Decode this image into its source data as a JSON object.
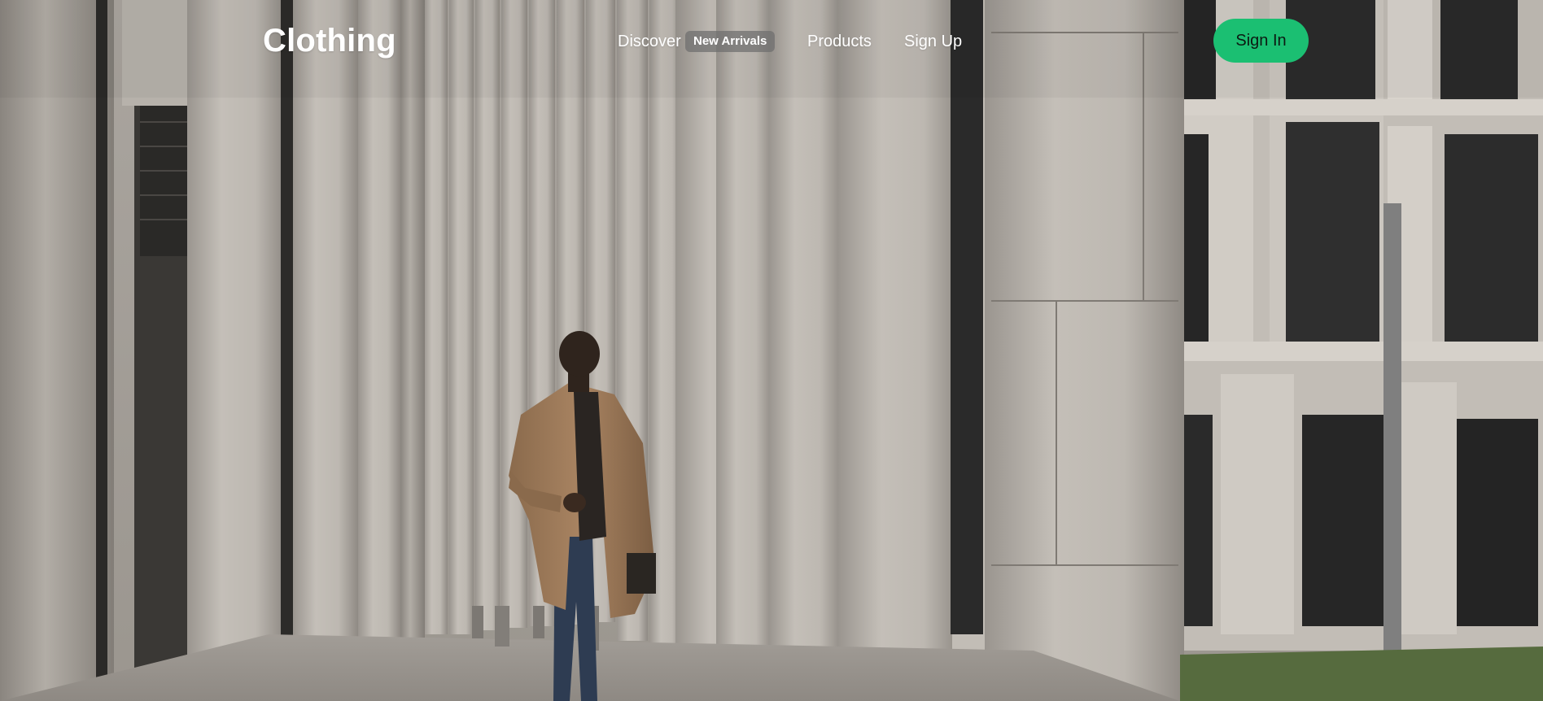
{
  "brand": {
    "logo_text": "Clothing"
  },
  "nav": {
    "discover_label": "Discover",
    "new_arrivals_badge": "New Arrivals",
    "products_label": "Products",
    "signup_label": "Sign Up"
  },
  "auth": {
    "signin_label": "Sign In"
  },
  "colors": {
    "accent": "#1bbf72",
    "badge_bg": "#6e6e6e",
    "header_text": "#ffffff"
  },
  "hero": {
    "image_description_icon": "hero-photo-man-walking-among-columns"
  }
}
